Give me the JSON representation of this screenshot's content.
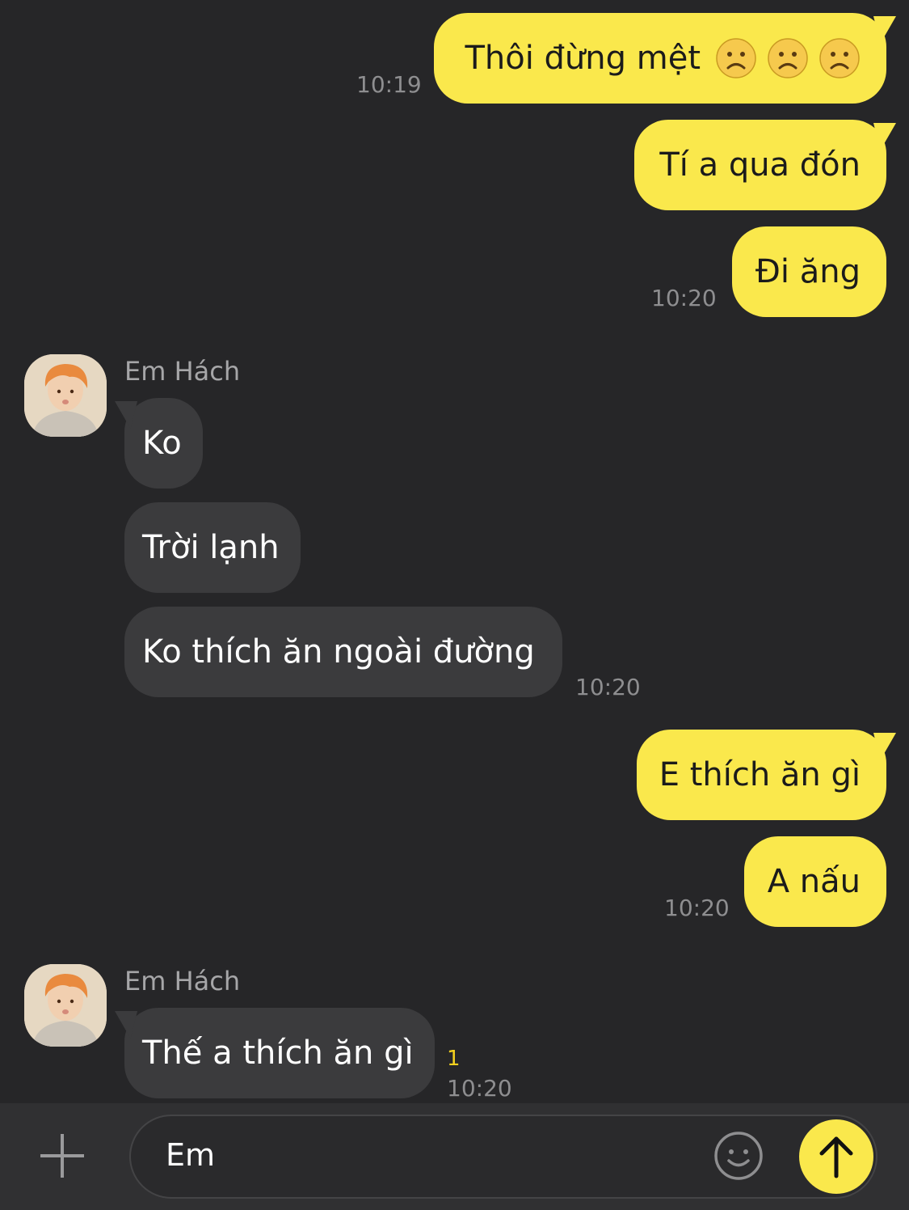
{
  "messages": {
    "m1": {
      "text": "Thôi đừng mệt",
      "emojis": [
        "frowning-face",
        "frowning-face",
        "frowning-face"
      ],
      "time": "10:19"
    },
    "m2": {
      "text": "Tí a qua đón"
    },
    "m3": {
      "text": "Đi ăng",
      "time": "10:20"
    },
    "group1": {
      "sender": "Em Hách"
    },
    "m4": {
      "text": "Ko"
    },
    "m5": {
      "text": "Trời lạnh"
    },
    "m6": {
      "text": "Ko thích ăn ngoài đường",
      "time": "10:20"
    },
    "m7": {
      "text": "E thích ăn gì"
    },
    "m8": {
      "text": "A nấu",
      "time": "10:20"
    },
    "group2": {
      "sender": "Em Hách"
    },
    "m9": {
      "text": "Thế a thích ăn gì",
      "unread": "1",
      "time": "10:20"
    }
  },
  "composer": {
    "value": "Em",
    "icons": [
      "plus-icon",
      "emoji-icon",
      "send-arrow-icon"
    ]
  },
  "colors": {
    "background": "#262628",
    "outgoing_bubble": "#fae84c",
    "incoming_bubble": "#3b3b3d",
    "unread": "#f5d11e"
  }
}
